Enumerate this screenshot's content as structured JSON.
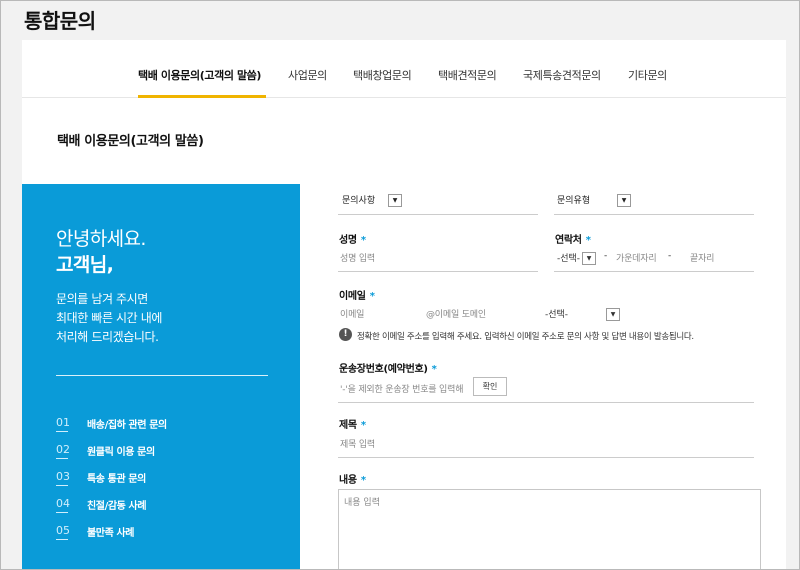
{
  "page": {
    "title": "통합문의"
  },
  "tabs": [
    {
      "label": "택배 이용문의(고객의 말씀)",
      "active": true
    },
    {
      "label": "사업문의",
      "active": false
    },
    {
      "label": "택배창업문의",
      "active": false
    },
    {
      "label": "택배견적문의",
      "active": false
    },
    {
      "label": "국제특송견적문의",
      "active": false
    },
    {
      "label": "기타문의",
      "active": false
    }
  ],
  "section": {
    "title": "택배 이용문의(고객의 말씀)"
  },
  "sidebar": {
    "greeting1": "안녕하세요.",
    "greeting2": "고객님,",
    "desc": [
      "문의를 남겨 주시면",
      "최대한 빠른 시간 내에",
      "처리해 드리겠습니다."
    ],
    "items": [
      {
        "num": "01",
        "label": "배송/집하 관련 문의"
      },
      {
        "num": "02",
        "label": "원클릭 이용 문의"
      },
      {
        "num": "03",
        "label": "특송 통관 문의"
      },
      {
        "num": "04",
        "label": "친절/감동 사례"
      },
      {
        "num": "05",
        "label": "불만족 사례"
      }
    ]
  },
  "form": {
    "inquiry_item": "문의사항",
    "inquiry_type": "문의유형",
    "name": {
      "label": "성명",
      "required": "*",
      "placeholder": "성명 입력"
    },
    "contact": {
      "label": "연락처",
      "required": "*",
      "select": "-선택-",
      "sep": "-",
      "mid": "가운데자리",
      "last": "끝자리"
    },
    "email": {
      "label": "이메일",
      "required": "*",
      "id_placeholder": "이메일",
      "domain_placeholder": "@이메일 도메인",
      "select": "-선택-",
      "notice": "정확한 이메일 주소를 입력해 주세요. 입력하신 이메일 주소로 문의 사항 및 답변 내용이 발송됩니다."
    },
    "tracking": {
      "label": "운송장번호(예약번호)",
      "required": "*",
      "placeholder": "'-'을 제외한 운송장 번호를 입력해",
      "button": "확인"
    },
    "subject": {
      "label": "제목",
      "required": "*",
      "placeholder": "제목 입력"
    },
    "content": {
      "label": "내용",
      "required": "*",
      "placeholder": "내용 입력"
    }
  },
  "icons": {
    "dropdown": "▼",
    "info": "!"
  },
  "colors": {
    "accent": "#0a9bd8",
    "tab_underline": "#f0b400"
  }
}
